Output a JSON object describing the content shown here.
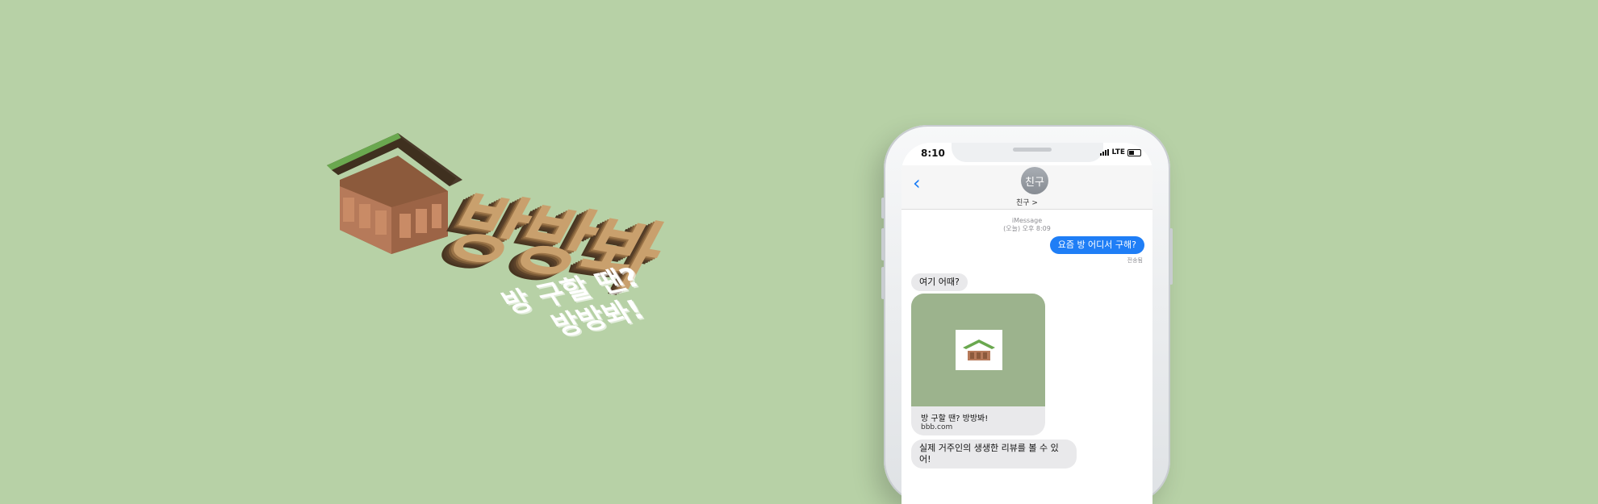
{
  "brand": {
    "wordmark": "방방봐",
    "slogan_line1": "방 구할 땐?",
    "slogan_line2": "방방봐!",
    "logo_letters": "bbb"
  },
  "colors": {
    "background": "#b7d1a6",
    "roof_green": "#6aa84f",
    "roof_dark": "#4a3a2a",
    "brick": "#b67a5a",
    "imessage_blue": "#1f7ef6"
  },
  "phone": {
    "status": {
      "time": "8:10",
      "network": "LTE"
    },
    "header": {
      "contact_avatar": "친구",
      "contact_name": "친구 >"
    },
    "service_label": "iMessage",
    "timestamp": "(오늘) 오후 8:09",
    "messages": {
      "outgoing_1": "요즘 방 어디서 구해?",
      "read_receipt": "전송됨",
      "incoming_1": "여기 어때?",
      "incoming_2": "실제 거주인의 생생한 리뷰를 볼 수 있어!"
    },
    "link_preview": {
      "title": "방 구할 땐? 방방봐!",
      "url": "bbb.com"
    }
  }
}
